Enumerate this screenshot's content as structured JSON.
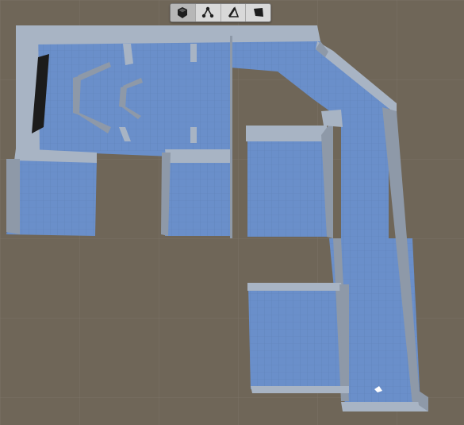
{
  "viewport": {
    "background_color": "#6f6658",
    "grid_color": "#7b7366",
    "floor_color": "#6a8fca",
    "floor_grid_color": "#5f82b8",
    "wall_top_color": "#a8b4c4",
    "wall_side_color": "#8e99a8",
    "dark_panel_color": "#1c1c1c"
  },
  "toolbar": {
    "active_tool": "object-mode",
    "tools": [
      {
        "id": "object-mode",
        "icon": "cube-icon"
      },
      {
        "id": "vertex-mode",
        "icon": "vertex-icon"
      },
      {
        "id": "edge-mode",
        "icon": "edge-icon"
      },
      {
        "id": "face-mode",
        "icon": "face-icon"
      }
    ]
  }
}
